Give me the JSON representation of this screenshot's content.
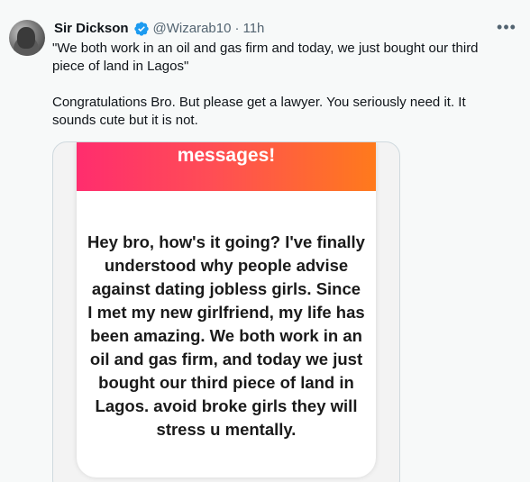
{
  "tweet": {
    "author_name": "Sir Dickson",
    "handle": "@Wizarab10",
    "separator": "·",
    "time": "11h",
    "more_label": "•••",
    "text_paragraphs": [
      "\"We both work in an oil and gas firm and today, we just bought our third piece of land in Lagos\"",
      "Congratulations Bro. But please get a lawyer. You seriously need it. It sounds cute but it is not."
    ],
    "verified_badge_color": "#1d9bf0"
  },
  "media": {
    "banner_text": "messages!",
    "banner_gradient": [
      "#ff2d6e",
      "#ff7a1c"
    ],
    "message_text": "Hey bro, how's it going? I've finally understood why people advise against dating jobless girls. Since I met my new girlfriend, my life has been amazing. We both work in an oil and gas firm, and today we just bought our third piece of land in Lagos. avoid broke girls they will stress u mentally."
  }
}
